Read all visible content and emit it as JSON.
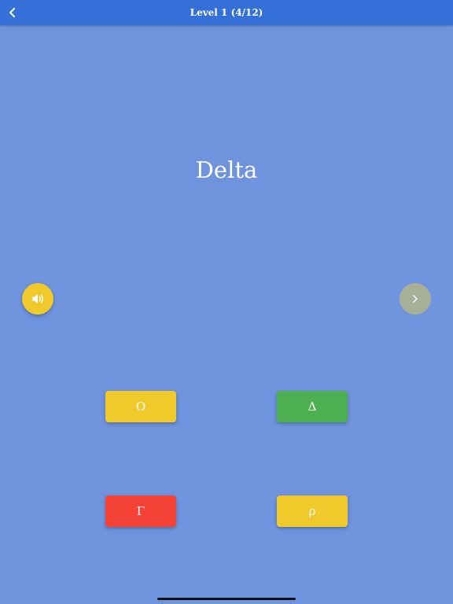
{
  "header": {
    "title": "Level 1 (4/12)",
    "back_icon": "chevron-left-icon"
  },
  "question": {
    "word": "Delta"
  },
  "controls": {
    "sound_icon": "speaker-icon",
    "sound_color": "#f0c92a",
    "next_icon": "chevron-right-icon",
    "next_color": "#b3b48c",
    "next_enabled": false
  },
  "choices": [
    {
      "label": "Ο",
      "color": "#f0c92a",
      "state": "neutral"
    },
    {
      "label": "Δ",
      "color": "#4caf50",
      "state": "correct"
    },
    {
      "label": "Γ",
      "color": "#f44336",
      "state": "wrong"
    },
    {
      "label": "ρ",
      "color": "#f0c92a",
      "state": "neutral"
    }
  ],
  "colors": {
    "background": "#6f93dc",
    "header": "#3470d8",
    "text": "#ffffff"
  }
}
